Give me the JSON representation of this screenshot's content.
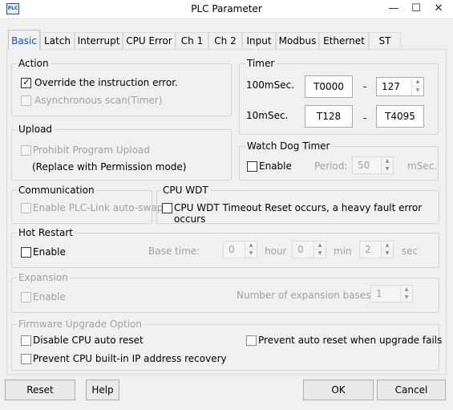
{
  "window": {
    "title": "PLC Parameter",
    "icon_label": "PLC",
    "minimize": "—",
    "maximize": "☐",
    "close": "✕"
  },
  "tabs": [
    "Basic",
    "Latch",
    "Interrupt",
    "CPU Error",
    "Ch 1",
    "Ch 2",
    "Input",
    "Modbus",
    "Ethernet",
    "ST"
  ],
  "active_tab": "Basic",
  "action": {
    "legend": "Action",
    "override_label": "Override the instruction error.",
    "override_checked": true,
    "async_label": "Asynchronous scan(Timer)",
    "async_checked": false
  },
  "timer": {
    "legend": "Timer",
    "row100_label": "100mSec.",
    "row100_from": "T0000",
    "row100_to": "127",
    "row10_label": "10mSec.",
    "row10_from": "T128",
    "row10_to": "T4095",
    "dash": "-"
  },
  "upload": {
    "legend": "Upload",
    "prohibit_label": "Prohibit Program Upload",
    "replace_note": "(Replace with Permission mode)"
  },
  "watchdog": {
    "legend": "Watch Dog Timer",
    "enable_label": "Enable",
    "period_label": "Period:",
    "period_value": "50",
    "unit": "mSec."
  },
  "communication": {
    "legend": "Communication",
    "plc_link_label": "Enable PLC-Link auto-swap"
  },
  "cpu_wdt": {
    "legend": "CPU WDT",
    "timeout_label": "CPU WDT Timeout Reset occurs, a heavy fault error occurs"
  },
  "hot_restart": {
    "legend": "Hot Restart",
    "enable_label": "Enable",
    "base_time_label": "Base time:",
    "hour_value": "0",
    "hour_label": "hour",
    "min_value": "0",
    "min_label": "min",
    "sec_value": "2",
    "sec_label": "sec"
  },
  "expansion": {
    "legend": "Expansion",
    "enable_label": "Enable",
    "bases_label": "Number of expansion bases",
    "bases_value": "1"
  },
  "firmware": {
    "legend": "Firmware Upgrade Option",
    "disable_reset_label": "Disable CPU auto reset",
    "prevent_reset_fail_label": "Prevent auto reset when upgrade fails",
    "prevent_ip_label": "Prevent CPU built-in IP address recovery"
  },
  "buttons": {
    "reset": "Reset",
    "help": "Help",
    "ok": "OK",
    "cancel": "Cancel"
  }
}
